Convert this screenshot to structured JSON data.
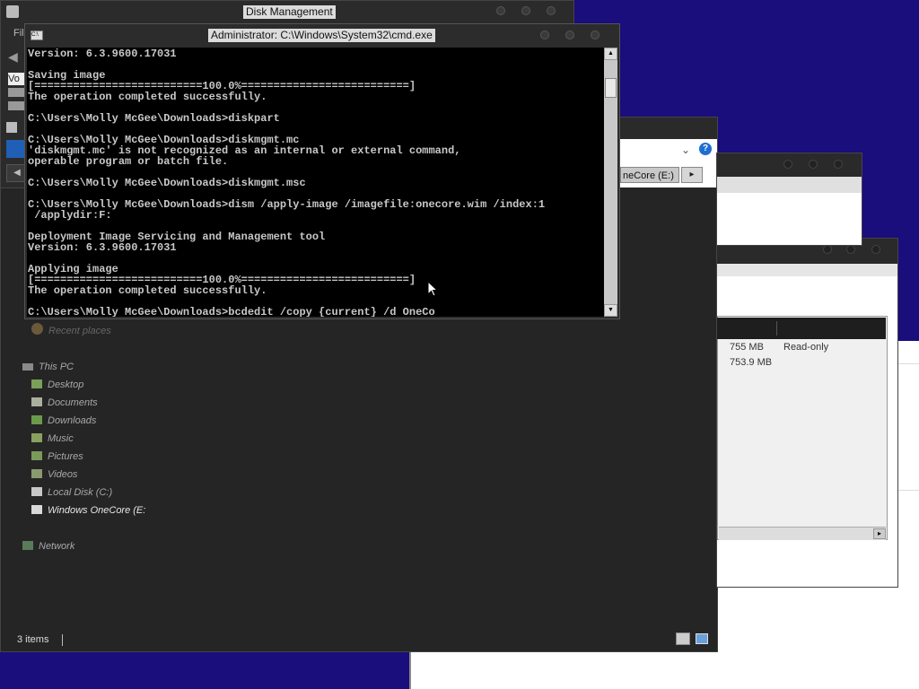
{
  "disk_management": {
    "title": "Disk Management",
    "menu_file": "Fil",
    "vol_header": "Vo"
  },
  "cmd": {
    "title": "Administrator: C:\\Windows\\System32\\cmd.exe",
    "lines": [
      "Version: 6.3.9600.17031",
      "",
      "Saving image",
      "[==========================100.0%==========================]",
      "The operation completed successfully.",
      "",
      "C:\\Users\\Molly McGee\\Downloads>diskpart",
      "",
      "C:\\Users\\Molly McGee\\Downloads>diskmgmt.mc",
      "'diskmgmt.mc' is not recognized as an internal or external command,",
      "operable program or batch file.",
      "",
      "C:\\Users\\Molly McGee\\Downloads>diskmgmt.msc",
      "",
      "C:\\Users\\Molly McGee\\Downloads>dism /apply-image /imagefile:onecore.wim /index:1",
      " /applydir:F:",
      "",
      "Deployment Image Servicing and Management tool",
      "Version: 6.3.9600.17031",
      "",
      "Applying image",
      "[==========================100.0%==========================]",
      "The operation completed successfully.",
      "",
      "C:\\Users\\Molly McGee\\Downloads>bcdedit /copy {current} /d OneCo"
    ]
  },
  "explorer": {
    "address_tail": "neCore (E:)",
    "recent_places": "Recent places",
    "this_pc": "This PC",
    "items": [
      {
        "label": "Desktop",
        "icon": "desktop-icon"
      },
      {
        "label": "Documents",
        "icon": "documents-icon"
      },
      {
        "label": "Downloads",
        "icon": "downloads-icon"
      },
      {
        "label": "Music",
        "icon": "music-icon"
      },
      {
        "label": "Pictures",
        "icon": "pictures-icon"
      },
      {
        "label": "Videos",
        "icon": "videos-icon"
      },
      {
        "label": "Local Disk (C:)",
        "icon": "drive-icon"
      },
      {
        "label": "Windows OneCore (E:",
        "icon": "drive-icon"
      }
    ],
    "network": "Network",
    "status": "3 items",
    "help": "?"
  },
  "properties": {
    "rows": [
      {
        "size": "755 MB",
        "attr": "Read-only"
      },
      {
        "size": "753.9 MB",
        "attr": ""
      }
    ]
  },
  "colors": {
    "desktop": "#1a0d7c",
    "explorer_bg": "#252525",
    "console_bg": "#000000"
  }
}
